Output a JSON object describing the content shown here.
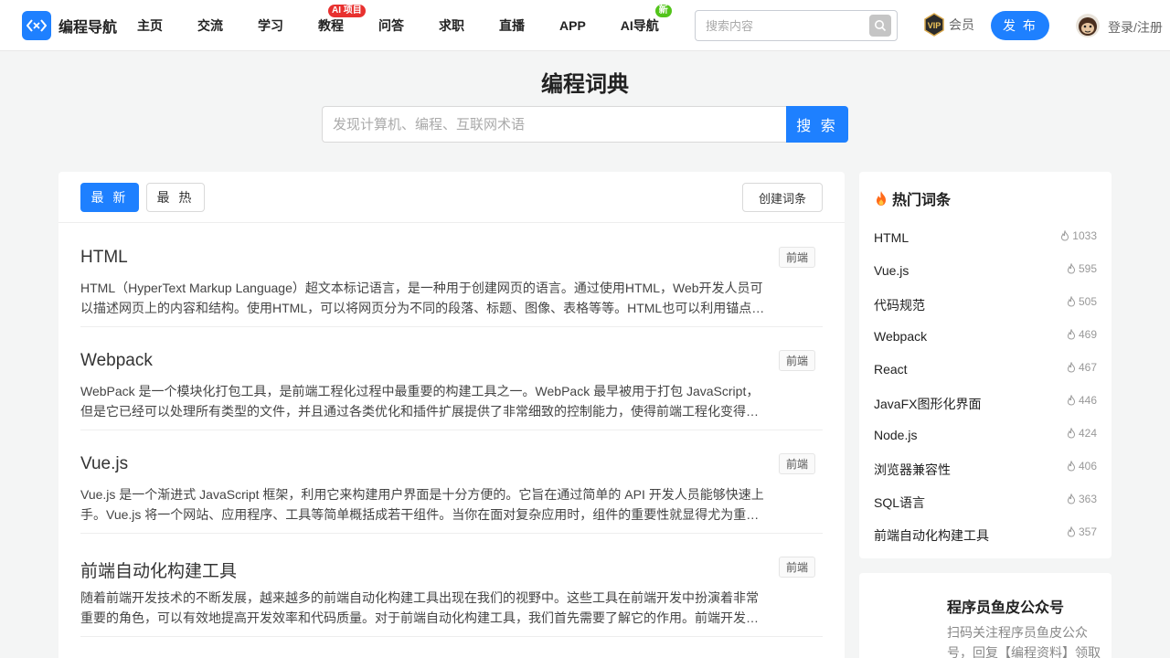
{
  "header": {
    "logo_text": "编程导航",
    "nav": [
      {
        "label": "主页"
      },
      {
        "label": "交流"
      },
      {
        "label": "学习"
      },
      {
        "label": "教程",
        "badge": "AI 项目"
      },
      {
        "label": "问答"
      },
      {
        "label": "求职"
      },
      {
        "label": "直播"
      },
      {
        "label": "APP"
      },
      {
        "label": "AI导航",
        "badge": "新"
      }
    ],
    "search_placeholder": "搜索内容",
    "vip_label": "会员",
    "vip_icon_text": "VIP",
    "publish_label": "发 布",
    "login_label": "登录/注册"
  },
  "dictionary": {
    "title": "编程词典",
    "search_placeholder": "发现计算机、编程、互联网术语",
    "search_button": "搜 索"
  },
  "list": {
    "tabs": {
      "latest": "最 新",
      "hot": "最 热"
    },
    "create_label": "创建词条",
    "entries": [
      {
        "title": "HTML",
        "tag": "前端",
        "desc": "HTML（HyperText Markup Language）超文本标记语言，是一种用于创建网页的语言。通过使用HTML，Web开发人员可以描述网页上的内容和结构。使用HTML，可以将网页分为不同的段落、标题、图像、表格等等。HTML也可以利用锚点和链接将不同的网页联系起来。"
      },
      {
        "title": "Webpack",
        "tag": "前端",
        "desc": "WebPack 是一个模块化打包工具，是前端工程化过程中最重要的构建工具之一。WebPack 最早被用于打包 JavaScript，但是它已经可以处理所有类型的文件，并且通过各类优化和插件扩展提供了非常细致的控制能力，使得前端工程化变得更加高效。"
      },
      {
        "title": "Vue.js",
        "tag": "前端",
        "desc": "Vue.js 是一个渐进式 JavaScript 框架，利用它来构建用户界面是十分方便的。它旨在通过简单的 API 开发人员能够快速上手。Vue.js 将一个网站、应用程序、工具等简单概括成若干组件。当你在面对复杂应用时，组件的重要性就显得尤为重要。"
      },
      {
        "title": "前端自动化构建工具",
        "tag": "前端",
        "desc": "随着前端开发技术的不断发展，越来越多的前端自动化构建工具出现在我们的视野中。这些工具在前端开发中扮演着非常重要的角色，可以有效地提高开发效率和代码质量。对于前端自动化构建工具，我们首先需要了解它的作用。前端开发过程中有很多重复的工作。"
      }
    ]
  },
  "hot": {
    "title": "热门词条",
    "items": [
      {
        "name": "HTML",
        "count": "1033"
      },
      {
        "name": "Vue.js",
        "count": "595"
      },
      {
        "name": "代码规范",
        "count": "505"
      },
      {
        "name": "Webpack",
        "count": "469"
      },
      {
        "name": "React",
        "count": "467"
      },
      {
        "name": "JavaFX图形化界面",
        "count": "446"
      },
      {
        "name": "Node.js",
        "count": "424"
      },
      {
        "name": "浏览器兼容性",
        "count": "406"
      },
      {
        "name": "SQL语言",
        "count": "363"
      },
      {
        "name": "前端自动化构建工具",
        "count": "357"
      }
    ]
  },
  "wechat": {
    "title": "程序员鱼皮公众号",
    "desc": "扫码关注程序员鱼皮公众号，回复【编程资料】领取"
  },
  "colors": {
    "accent": "#1e80ff",
    "badge_red": "#e8312f",
    "badge_green": "#52c41a"
  }
}
